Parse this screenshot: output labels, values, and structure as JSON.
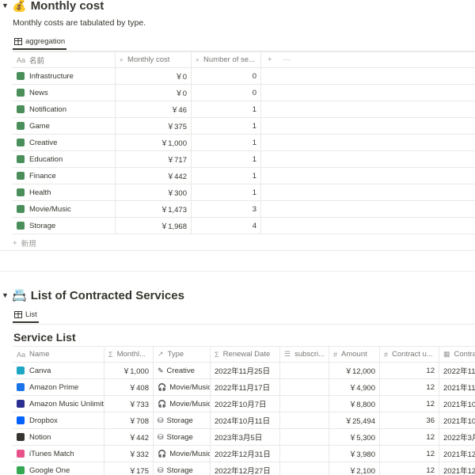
{
  "section1": {
    "toggle": "▼",
    "emoji": "💰",
    "title": "Monthly cost",
    "description": "Monthly costs are tabulated by type.",
    "view_tab": "aggregation",
    "columns": [
      "名前",
      "Monthly cost",
      "Number of se..."
    ],
    "column_icons": [
      "Aa",
      "⌕",
      "⌕"
    ],
    "add_col": "+",
    "more": "···",
    "rows": [
      {
        "name": "Infrastructure",
        "cost": "￥0",
        "count": "0",
        "icon_color": "#4a8f5a"
      },
      {
        "name": "News",
        "cost": "￥0",
        "count": "0",
        "icon_color": "#4a8f5a"
      },
      {
        "name": "Notification",
        "cost": "￥46",
        "count": "1",
        "icon_color": "#4a8f5a"
      },
      {
        "name": "Game",
        "cost": "￥375",
        "count": "1",
        "icon_color": "#4a8f5a"
      },
      {
        "name": "Creative",
        "cost": "￥1,000",
        "count": "1",
        "icon_color": "#4a8f5a"
      },
      {
        "name": "Education",
        "cost": "￥717",
        "count": "1",
        "icon_color": "#4a8f5a"
      },
      {
        "name": "Finance",
        "cost": "￥442",
        "count": "1",
        "icon_color": "#4a8f5a"
      },
      {
        "name": "Health",
        "cost": "￥300",
        "count": "1",
        "icon_color": "#4a8f5a"
      },
      {
        "name": "Movie/Music",
        "cost": "￥1,473",
        "count": "3",
        "icon_color": "#4a8f5a"
      },
      {
        "name": "Storage",
        "cost": "￥1,968",
        "count": "4",
        "icon_color": "#4a8f5a"
      }
    ],
    "new_label": "新規"
  },
  "section2": {
    "toggle": "▼",
    "emoji": "📇",
    "title": "List of Contracted Services",
    "view_tab": "List",
    "list_title": "Service List",
    "columns": [
      "Name",
      "Monthl...",
      "Type",
      "Renewal Date",
      "subscri...",
      "Amount",
      "Contract u...",
      "Contra"
    ],
    "column_icons": [
      "Aa",
      "Σ",
      "↗",
      "Σ",
      "☰",
      "#",
      "#",
      "▦"
    ],
    "rows": [
      {
        "name": "Canva",
        "monthly": "￥1,000",
        "type": "Creative",
        "type_icon": "✎",
        "renewal": "2022年11月25日",
        "amount": "￥12,000",
        "contract": "12",
        "contra": "2022年11",
        "icon_color": "#1ea7c4"
      },
      {
        "name": "Amazon Prime",
        "monthly": "￥408",
        "type": "Movie/Music",
        "type_icon": "🎧",
        "renewal": "2022年11月17日",
        "amount": "￥4,900",
        "contract": "12",
        "contra": "2021年11",
        "icon_color": "#1a73e8"
      },
      {
        "name": "Amazon Music Unlimit",
        "monthly": "￥733",
        "type": "Movie/Music",
        "type_icon": "🎧",
        "renewal": "2022年10月7日",
        "amount": "￥8,800",
        "contract": "12",
        "contra": "2021年10",
        "icon_color": "#2b2f8f"
      },
      {
        "name": "Dropbox",
        "monthly": "￥708",
        "type": "Storage",
        "type_icon": "⛁",
        "renewal": "2024年10月11日",
        "amount": "￥25,494",
        "contract": "36",
        "contra": "2021年10",
        "icon_color": "#0061fe"
      },
      {
        "name": "Notion",
        "monthly": "￥442",
        "type": "Storage",
        "type_icon": "⛁",
        "renewal": "2023年3月5日",
        "amount": "￥5,300",
        "contract": "12",
        "contra": "2022年3月",
        "icon_color": "#37352f"
      },
      {
        "name": "iTunes Match",
        "monthly": "￥332",
        "type": "Movie/Music",
        "type_icon": "🎧",
        "renewal": "2022年12月31日",
        "amount": "￥3,980",
        "contract": "12",
        "contra": "2021年12",
        "icon_color": "#e8518a"
      },
      {
        "name": "Google One",
        "monthly": "￥175",
        "type": "Storage",
        "type_icon": "⛁",
        "renewal": "2022年12月27日",
        "amount": "￥2,100",
        "contract": "12",
        "contra": "2021年12",
        "icon_color": "#34a853"
      }
    ]
  }
}
